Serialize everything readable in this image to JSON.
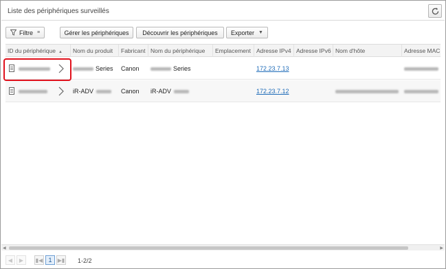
{
  "window": {
    "title": "Liste des périphériques surveillés"
  },
  "toolbar": {
    "filter_label": "Filtre",
    "manage_label": "Gérer les périphériques",
    "discover_label": "Découvrir les périphériques",
    "export_label": "Exporter"
  },
  "table": {
    "columns": [
      "ID du périphérique",
      "Nom du produit",
      "Fabricant",
      "Nom du périphérique",
      "Emplacement",
      "Adresse IPv4",
      "Adresse IPv6",
      "Nom d'hôte",
      "Adresse MAC"
    ],
    "sorted_column": "ID du périphérique",
    "rows": [
      {
        "product_suffix": "Series",
        "manufacturer": "Canon",
        "device_name_suffix": "Series",
        "ipv4": "172.23.7.13"
      },
      {
        "product_prefix": "iR-ADV",
        "manufacturer": "Canon",
        "device_name_prefix": "iR-ADV",
        "ipv4": "172.23.7.12"
      }
    ]
  },
  "pager": {
    "current_page": "1",
    "range": "1-2/2"
  },
  "colors": {
    "link": "#1e6bb8",
    "highlight_border": "#e0101b"
  },
  "icons": [
    "refresh-icon",
    "filter-icon",
    "document-icon",
    "chevron-right-icon",
    "sort-ascending-icon"
  ]
}
